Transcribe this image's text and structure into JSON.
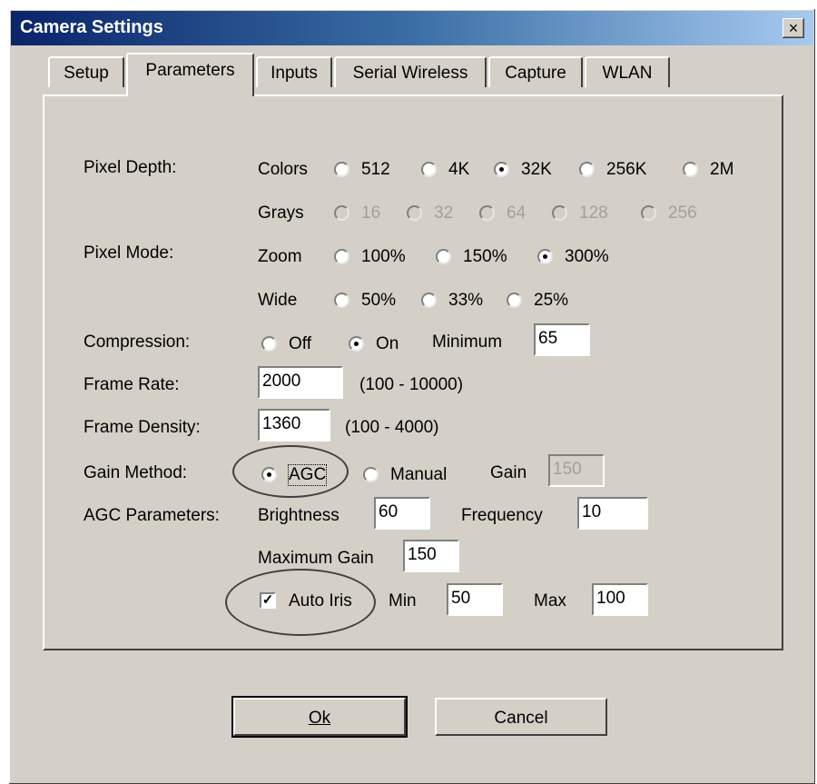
{
  "window": {
    "title": "Camera Settings",
    "close_label": "×"
  },
  "tabs": [
    "Setup",
    "Parameters",
    "Inputs",
    "Serial Wireless",
    "Capture",
    "WLAN"
  ],
  "pixel_depth": {
    "label": "Pixel Depth:",
    "colors_label": "Colors",
    "colors": [
      "512",
      "4K",
      "32K",
      "256K",
      "2M"
    ],
    "colors_selected": "32K",
    "grays_label": "Grays",
    "grays": [
      "16",
      "32",
      "64",
      "128",
      "256"
    ]
  },
  "pixel_mode": {
    "label": "Pixel Mode:",
    "zoom_label": "Zoom",
    "zoom": [
      "100%",
      "150%",
      "300%"
    ],
    "zoom_selected": "300%",
    "wide_label": "Wide",
    "wide": [
      "50%",
      "33%",
      "25%"
    ]
  },
  "compression": {
    "label": "Compression:",
    "off": "Off",
    "on": "On",
    "selected": "On",
    "minimum_label": "Minimum",
    "minimum_value": "65"
  },
  "frame_rate": {
    "label": "Frame Rate:",
    "value": "2000",
    "range": "(100 - 10000)"
  },
  "frame_density": {
    "label": "Frame Density:",
    "value": "1360",
    "range": "(100 - 4000)"
  },
  "gain_method": {
    "label": "Gain Method:",
    "agc": "AGC",
    "manual": "Manual",
    "selected": "AGC",
    "gain_label": "Gain",
    "gain_value": "150"
  },
  "agc_parameters": {
    "label": "AGC Parameters:",
    "brightness_label": "Brightness",
    "brightness_value": "60",
    "frequency_label": "Frequency",
    "frequency_value": "10",
    "max_gain_label": "Maximum Gain",
    "max_gain_value": "150"
  },
  "auto_iris": {
    "label": "Auto Iris",
    "checked": true,
    "min_label": "Min",
    "min_value": "50",
    "max_label": "Max",
    "max_value": "100"
  },
  "buttons": {
    "ok": "Ok",
    "cancel": "Cancel"
  }
}
